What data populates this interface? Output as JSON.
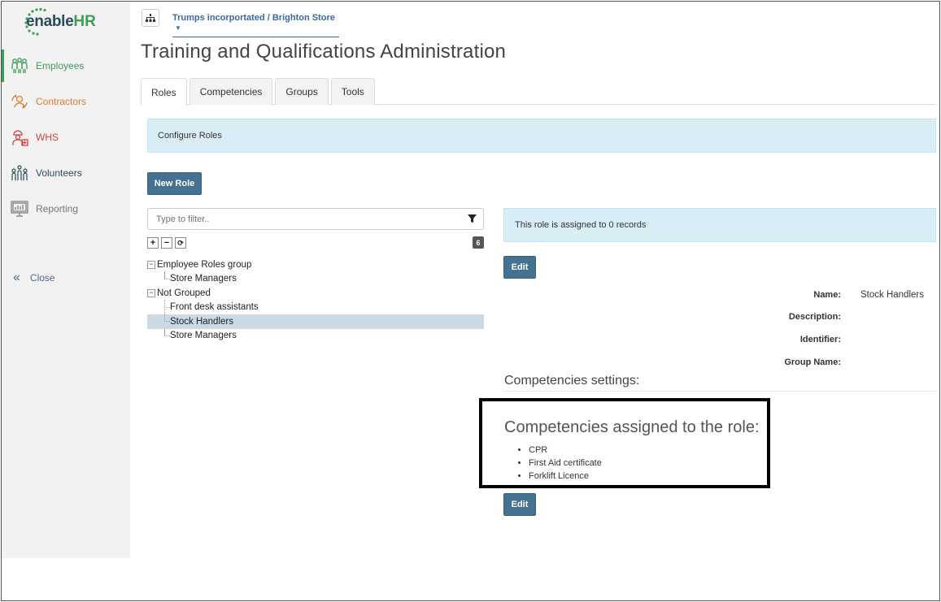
{
  "app": {
    "logo_text_enable": "enable",
    "logo_text_hr": "HR",
    "brand_green": "#3a9f57",
    "brand_navy": "#2b4c5a"
  },
  "sidebar": {
    "items": [
      {
        "label": "Employees",
        "icon": "employees-icon",
        "color": "#3a9f57",
        "active": true
      },
      {
        "label": "Contractors",
        "icon": "contractors-icon",
        "color": "#e07b2e",
        "active": false
      },
      {
        "label": "WHS",
        "icon": "whs-icon",
        "color": "#d14343",
        "active": false
      },
      {
        "label": "Volunteers",
        "icon": "volunteers-icon",
        "color": "#2b4c5a",
        "active": false
      },
      {
        "label": "Reporting",
        "icon": "reporting-icon",
        "color": "#777777",
        "active": false
      }
    ],
    "close_label": "Close"
  },
  "header": {
    "org_selector": "Trumps incorportated / Brighton Store",
    "page_title": "Training and Qualifications Administration"
  },
  "tabs": [
    {
      "label": "Roles",
      "active": true
    },
    {
      "label": "Competencies",
      "active": false
    },
    {
      "label": "Groups",
      "active": false
    },
    {
      "label": "Tools",
      "active": false
    }
  ],
  "roles": {
    "configure_banner": "Configure Roles",
    "new_role_label": "New Role",
    "filter_placeholder": "Type to filter..",
    "count_badge": "6",
    "tree": [
      {
        "label": "Employee Roles group",
        "type": "group"
      },
      {
        "label": "Store Managers",
        "type": "child"
      },
      {
        "label": "Not Grouped",
        "type": "group"
      },
      {
        "label": "Front desk assistants",
        "type": "child"
      },
      {
        "label": "Stock Handlers",
        "type": "child",
        "selected": true
      },
      {
        "label": "Store Managers",
        "type": "child"
      }
    ]
  },
  "detail": {
    "records_banner": "This role is assigned to 0 records",
    "edit_label": "Edit",
    "fields": {
      "name_label": "Name:",
      "name_value": "Stock Handlers",
      "description_label": "Description:",
      "identifier_label": "Identifier:",
      "group_name_label": "Group Name:"
    },
    "competencies_settings_title": "Competencies settings:",
    "assigned_title": "Competencies assigned to the role:",
    "assigned": [
      "CPR",
      "First Aid certificate",
      "Forklift Licence"
    ],
    "edit2_label": "Edit"
  }
}
